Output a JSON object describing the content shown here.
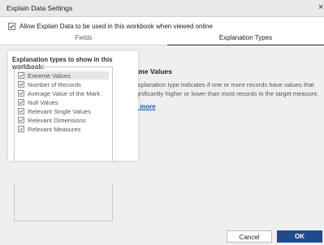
{
  "window": {
    "title": "Explain Data Settings"
  },
  "allow": {
    "label": "Allow Explain Data to be used in this workbook when viewed online",
    "checked": true
  },
  "tabs": [
    {
      "label": "Fields",
      "active": false
    },
    {
      "label": "Explanation Types",
      "active": true
    }
  ],
  "types_panel": {
    "heading": "Explanation types to show in this workbook:",
    "options": [
      {
        "label": "Extreme Values",
        "checked": true,
        "selected": true
      },
      {
        "label": "Number of Records",
        "checked": true,
        "selected": false
      },
      {
        "label": "Average Value of the Mark",
        "checked": true,
        "selected": false
      },
      {
        "label": "Null Values",
        "checked": true,
        "selected": false
      },
      {
        "label": "Relevant Single Values",
        "checked": true,
        "selected": false
      },
      {
        "label": "Relevant Dimensions",
        "checked": true,
        "selected": false
      },
      {
        "label": "Relevant Measures",
        "checked": true,
        "selected": false
      }
    ]
  },
  "detail": {
    "title": "Extreme Values",
    "description": "This explanation type indicates if one or more records have values that are significantly higher or lower than most records in the target measure.",
    "link": "Learn more"
  },
  "buttons": {
    "cancel": "Cancel",
    "ok": "OK"
  },
  "colors": {
    "primary": "#1f4b8e",
    "link": "#1a5fa8",
    "overlay": "#efefef"
  },
  "icons": {
    "close": "close-icon",
    "check": "checkmark-icon"
  }
}
